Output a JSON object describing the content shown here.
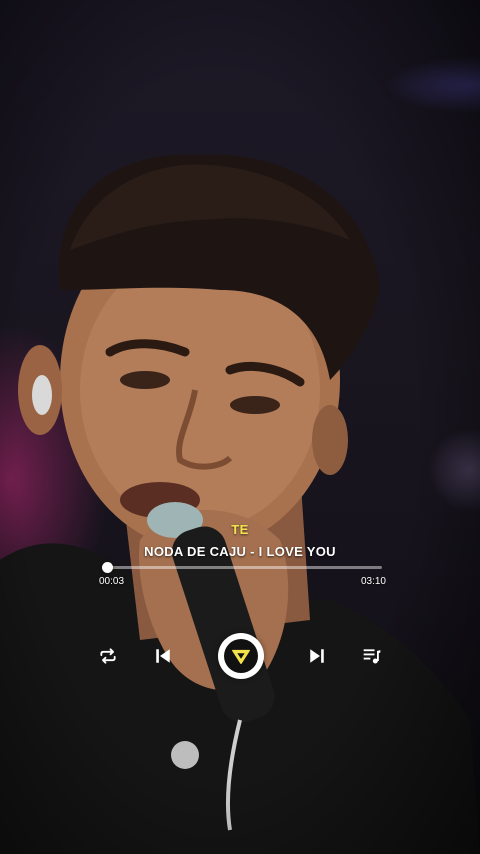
{
  "player": {
    "lyric": "TE",
    "title": "NODA DE CAJU - I LOVE YOU",
    "elapsed": "00:03",
    "duration": "03:10",
    "progress_fraction": 0.016,
    "accent_color": "#f2e24c"
  },
  "controls": {
    "repeat_icon": "repeat-icon",
    "previous_icon": "skip-previous-icon",
    "play_icon": "play-triangle-icon",
    "next_icon": "skip-next-icon",
    "queue_icon": "playlist-icon"
  }
}
